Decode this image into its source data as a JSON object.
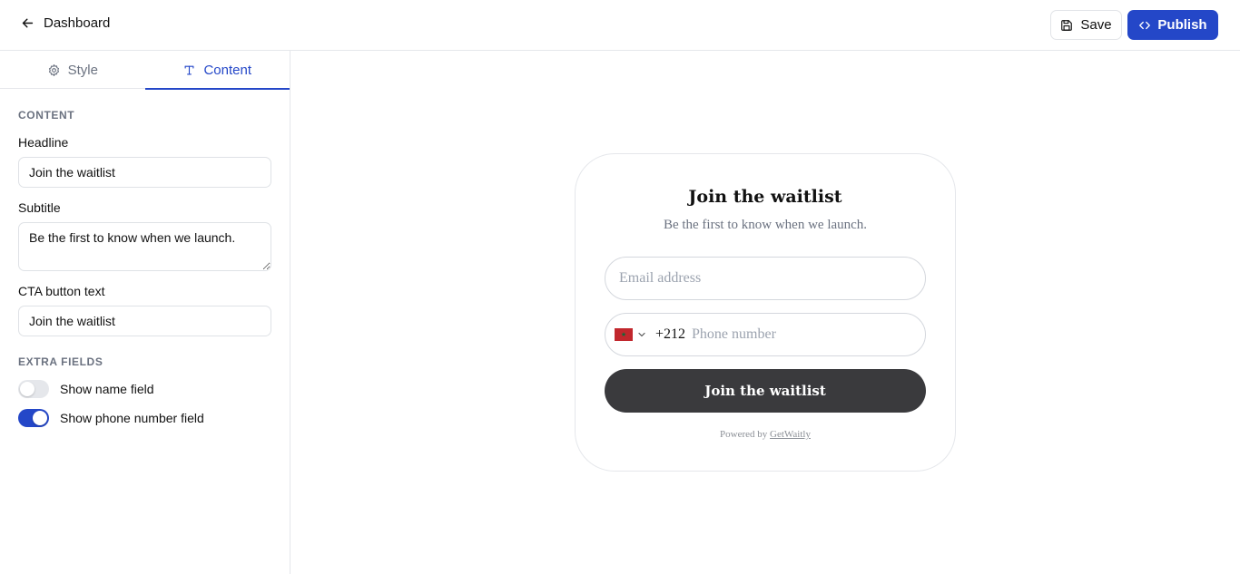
{
  "topbar": {
    "back_label": "Dashboard",
    "save_label": "Save",
    "publish_label": "Publish"
  },
  "tabs": [
    {
      "label": "Style",
      "active": false
    },
    {
      "label": "Content",
      "active": true
    }
  ],
  "content_section": {
    "heading": "CONTENT",
    "headline_label": "Headline",
    "headline_value": "Join the waitlist",
    "subtitle_label": "Subtitle",
    "subtitle_value": "Be the first to know when we launch.",
    "cta_label": "CTA button text",
    "cta_value": "Join the waitlist"
  },
  "extra_fields": {
    "heading": "EXTRA FIELDS",
    "toggles": [
      {
        "label": "Show name field",
        "on": false
      },
      {
        "label": "Show phone number field",
        "on": true
      }
    ]
  },
  "preview": {
    "title": "Join the waitlist",
    "subtitle": "Be the first to know when we launch.",
    "email_placeholder": "Email address",
    "dial_code": "+212",
    "phone_placeholder": "Phone number",
    "cta": "Join the waitlist",
    "powered_prefix": "Powered by",
    "powered_link": "GetWaitly"
  },
  "colors": {
    "accent": "#2447c8",
    "cta_bg": "#3a3a3d",
    "flag_red": "#c1272d",
    "flag_star": "#0a6b3a"
  },
  "icons": {
    "back": "arrow-left-icon",
    "save": "floppy-disk-icon",
    "publish": "code-icon",
    "style_tab": "gear-icon",
    "content_tab": "text-icon",
    "country": "morocco-flag-icon",
    "dropdown": "chevron-down-icon"
  }
}
